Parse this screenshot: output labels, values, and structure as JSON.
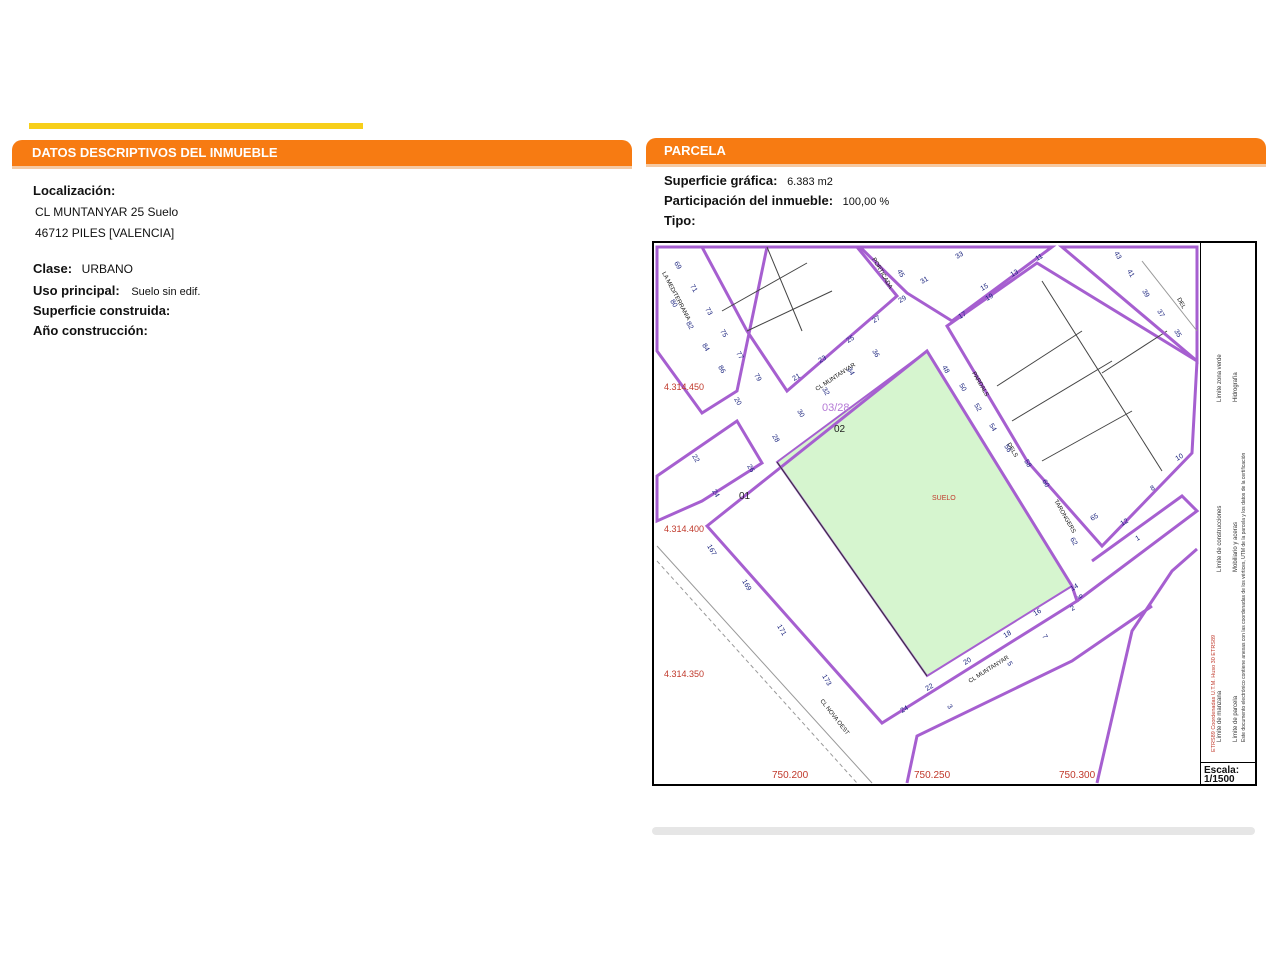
{
  "left_section": {
    "header": "DATOS DESCRIPTIVOS DEL INMUEBLE",
    "localizacion_label": "Localización:",
    "address_line1": "CL MUNTANYAR 25 Suelo",
    "address_line2": "46712 PILES [VALENCIA]",
    "clase_label": "Clase:",
    "clase_value": "URBANO",
    "uso_label": "Uso principal:",
    "uso_value": "Suelo sin edif.",
    "superficie_label": "Superficie construida:",
    "anio_label": "Año construcción:"
  },
  "right_section": {
    "header": "PARCELA",
    "superficie_label": "Superficie gráfica:",
    "superficie_value": "6.383 m2",
    "participacion_label": "Participación del inmueble:",
    "participacion_value": "100,00 %",
    "tipo_label": "Tipo:"
  },
  "map": {
    "parcel_label": "SUELO",
    "parcel_ref": "03/28",
    "sub_01": "01",
    "sub_02": "02",
    "coord_y1": "4.314.450",
    "coord_y2": "4.314.400",
    "coord_y3": "4.314.350",
    "coord_x1": "750.200",
    "coord_x2": "750.250",
    "coord_x3": "750.300",
    "street_la_mediterrania": "LA MEDITERRANIA",
    "street_muntanyar_top": "CL MUNTANYAR",
    "street_pardals": "PARDALS",
    "street_dels": "DELS",
    "street_taronges": "TARONGERS",
    "street_muntanyar_bottom": "CL MUNTANYAR",
    "street_nova_oest": "CL NOVA OEST",
    "street_top_left": "PORTICADA",
    "street_right": "DEL",
    "legend_items": [
      "Límite de manzana",
      "Límite de parcela",
      "Límite de construcciones",
      "Mobiliario y aceras",
      "Límite zona verde",
      "Hidrografía"
    ],
    "legend_note": "Este documento electrónico contiene anexas con las coordenadas de los vértices, UTM de la parcela y los datos de la certificación",
    "legend_coords": "ETRS89 Coordenadas U.T.M. Huso 30 ETRS89",
    "scale_label": "Escala:",
    "scale_value": "1/1500",
    "numbers": [
      "69",
      "71",
      "73",
      "75",
      "77",
      "79",
      "80",
      "82",
      "84",
      "86",
      "20",
      "22",
      "24",
      "26",
      "28",
      "30",
      "32",
      "34",
      "36",
      "21",
      "23",
      "25",
      "27",
      "29",
      "31",
      "33",
      "167",
      "169",
      "171",
      "173",
      "24",
      "22",
      "20",
      "18",
      "16",
      "14",
      "12",
      "48",
      "50",
      "52",
      "54",
      "56",
      "58",
      "60",
      "62",
      "1",
      "2",
      "3",
      "5",
      "7",
      "9",
      "45",
      "15",
      "13",
      "11",
      "17",
      "19",
      "43",
      "41",
      "39",
      "37",
      "35",
      "65",
      "8",
      "10"
    ]
  },
  "colors": {
    "header_orange": "#f77b12",
    "yellow_accent": "#f7cf1a",
    "parcel_fill": "#d6f5cf",
    "block_outline": "#a65fd0",
    "coord_red": "#c0392b",
    "numbers_blue": "#1a237e"
  }
}
